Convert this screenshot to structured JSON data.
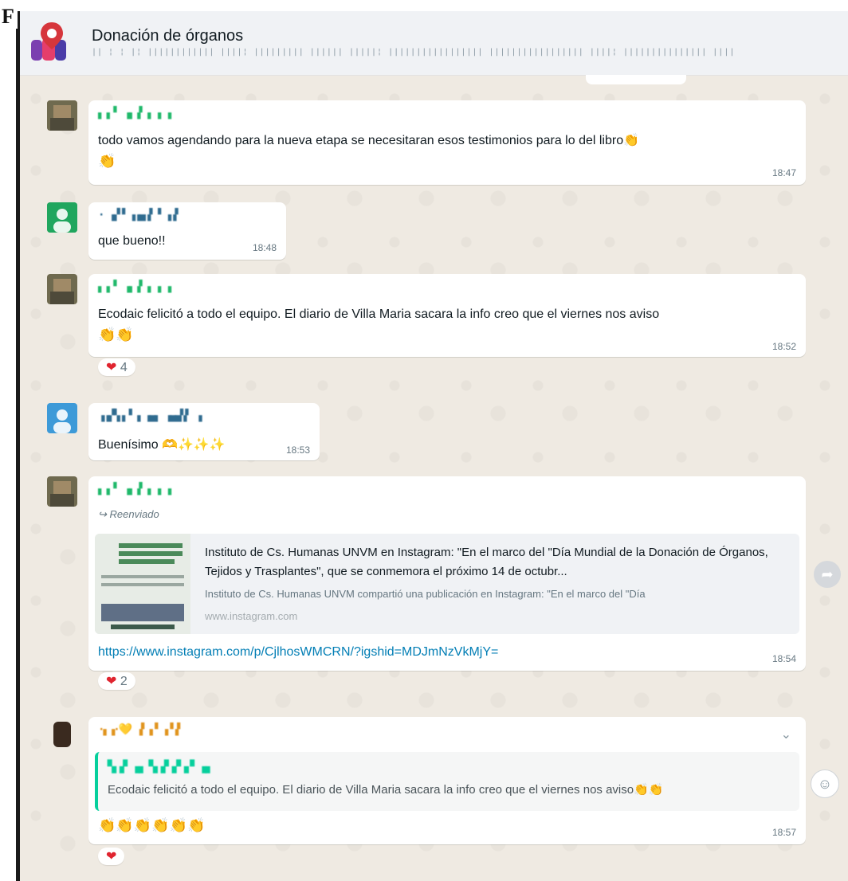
{
  "figure_label": "F",
  "header": {
    "title": "Donación de órganos",
    "members": "|| ¦ ¦ |¦ |||||||||||| ||||¦ ||||||||| |||||| |||||¦ ||||||||||||||||| ||||||||||||||||| ||||¦ ||||||||||||||| ||||"
  },
  "messages": [
    {
      "sender": "▖▗ ▘ ▗▖▗▘▗ ▗ ▗",
      "text": "todo  vamos agendando para la nueva etapa se necesitaran esos testimonios para lo del libro👏",
      "text2": "👏",
      "time": "18:47"
    },
    {
      "sender": "· ▗▞▝  ▗▗▄▗▘▝ ▗▗▘",
      "text": "que bueno!!",
      "time": "18:48"
    },
    {
      "sender": "▖▗ ▘ ▗▖▗▘▗ ▗ ▗",
      "text": "Ecodaic felicitó a todo el equipo. El diario de Villa Maria sacara la info creo que el viernes nos aviso",
      "text2": "👏👏",
      "time": "18:52",
      "reaction": {
        "icon": "❤",
        "count": "4"
      }
    },
    {
      "sender": "▗▗▞▚▗ ▘▗ ▗▄▖ ▗▄▄▚▘ ▗",
      "text": "Buenísimo 🫶✨✨✨",
      "time": "18:53"
    },
    {
      "sender": "▖▗ ▘ ▗▖▗▘▗ ▗ ▗",
      "forwarded": "Reenviado",
      "preview": {
        "title": "Instituto de Cs. Humanas UNVM en Instagram: \"En el marco del \"Día Mundial de la Donación de Órganos, Tejidos y Trasplantes\", que se conmemora el próximo 14 de octubr...",
        "desc": "Instituto de Cs. Humanas UNVM compartió una publicación en Instagram: \"En el marco del \"Día",
        "url": "www.instagram.com"
      },
      "link": "https://www.instagram.com/p/CjlhosWMCRN/?igshid=MDJmNzVkMjY=",
      "time": "18:54",
      "reaction": {
        "icon": "❤",
        "count": "2"
      }
    },
    {
      "sender": "·▖▗·💛  ▗▘▗▝ ▗▝▗▘",
      "quote_sender": "▚▗▘▗▖ ▚▗▘▞▗ ▘▗▖",
      "quote_text": "Ecodaic felicitó a todo el equipo. El diario de Villa Maria sacara la info creo que el viernes nos aviso👏👏",
      "text": "👏👏👏👏👏👏",
      "time": "18:57",
      "reaction": {
        "icon": "❤",
        "count": ""
      }
    }
  ],
  "icons": {
    "forward": "➦",
    "forward_arrow": "↪",
    "emoji_picker": "☺",
    "chevron": "⌄"
  },
  "colors": {
    "sender_green": "#1fb86a",
    "sender_gray": "#2f6b8f",
    "quote_accent": "#06cf9c",
    "link": "#027eb5"
  }
}
